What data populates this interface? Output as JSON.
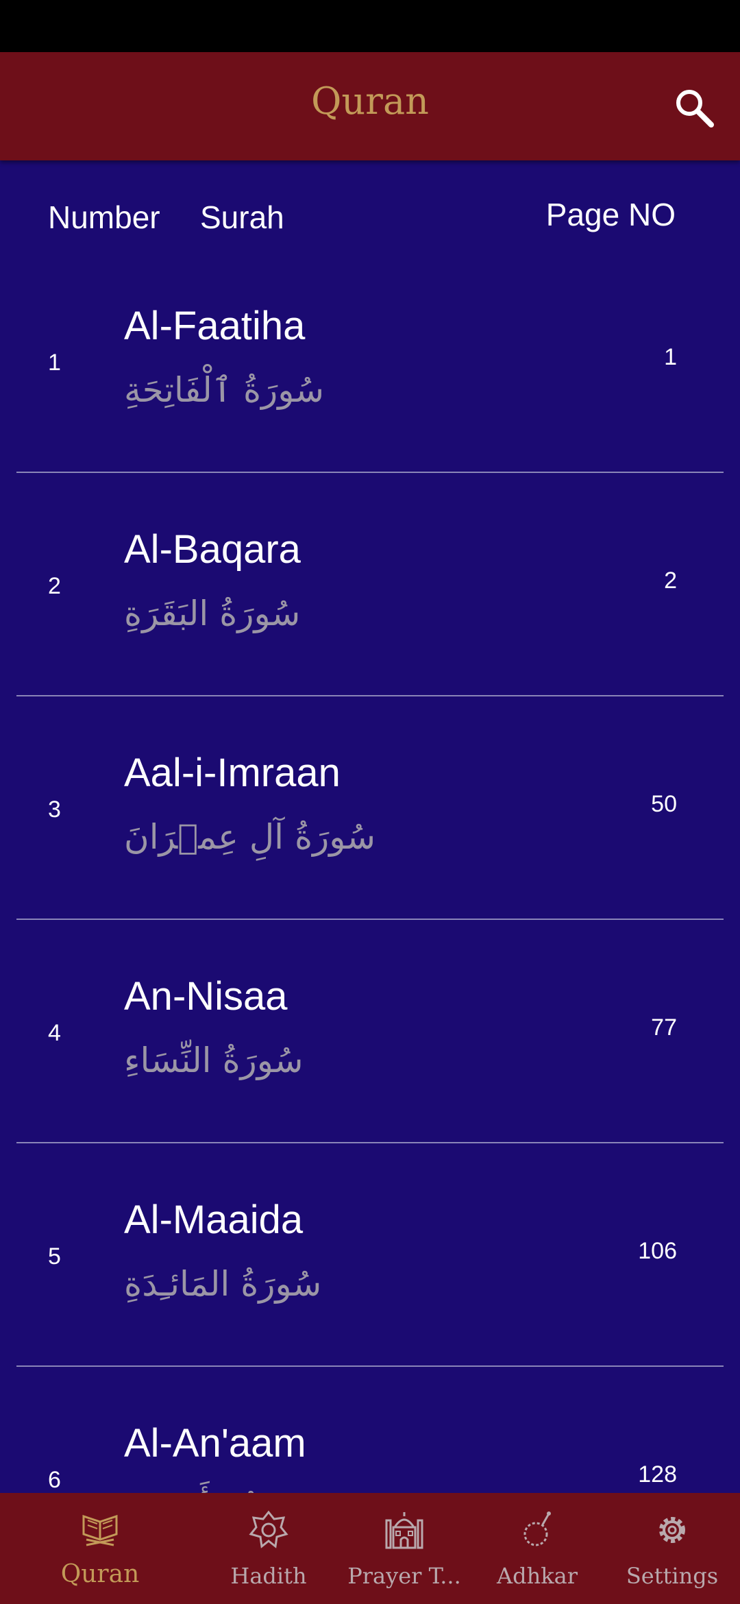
{
  "header": {
    "title": "Quran",
    "search_icon": "search-icon"
  },
  "columns": {
    "number": "Number",
    "surah": "Surah",
    "page": "Page NO"
  },
  "surahs": [
    {
      "number": "1",
      "name": "Al-Faatiha",
      "arabic": "سُورَةُ ٱلْفَاتِحَةِ",
      "page": "1"
    },
    {
      "number": "2",
      "name": "Al-Baqara",
      "arabic": "سُورَةُ البَقَرَةِ",
      "page": "2"
    },
    {
      "number": "3",
      "name": "Aal-i-Imraan",
      "arabic": "سُورَةُ آلِ عِمۡرَانَ",
      "page": "50"
    },
    {
      "number": "4",
      "name": "An-Nisaa",
      "arabic": "سُورَةُ النِّسَاءِ",
      "page": "77"
    },
    {
      "number": "5",
      "name": "Al-Maaida",
      "arabic": "سُورَةُ المَائـِدَةِ",
      "page": "106"
    },
    {
      "number": "6",
      "name": "Al-An'aam",
      "arabic": "سُورَةُ الأَنۡعَامِ",
      "page": "128"
    }
  ],
  "nav": [
    {
      "label": "Quran",
      "icon": "quran-book-icon",
      "active": true
    },
    {
      "label": "Hadith",
      "icon": "star-badge-icon",
      "active": false
    },
    {
      "label": "Prayer T...",
      "icon": "mosque-icon",
      "active": false
    },
    {
      "label": "Adhkar",
      "icon": "prayer-beads-icon",
      "active": false
    },
    {
      "label": "Settings",
      "icon": "gear-icon",
      "active": false
    }
  ],
  "colors": {
    "app_bar": "#6e0f19",
    "background": "#1b0a72",
    "accent_gold": "#c39a58",
    "arabic_text": "#9b96a6",
    "inactive_nav": "#b9a9ad"
  }
}
